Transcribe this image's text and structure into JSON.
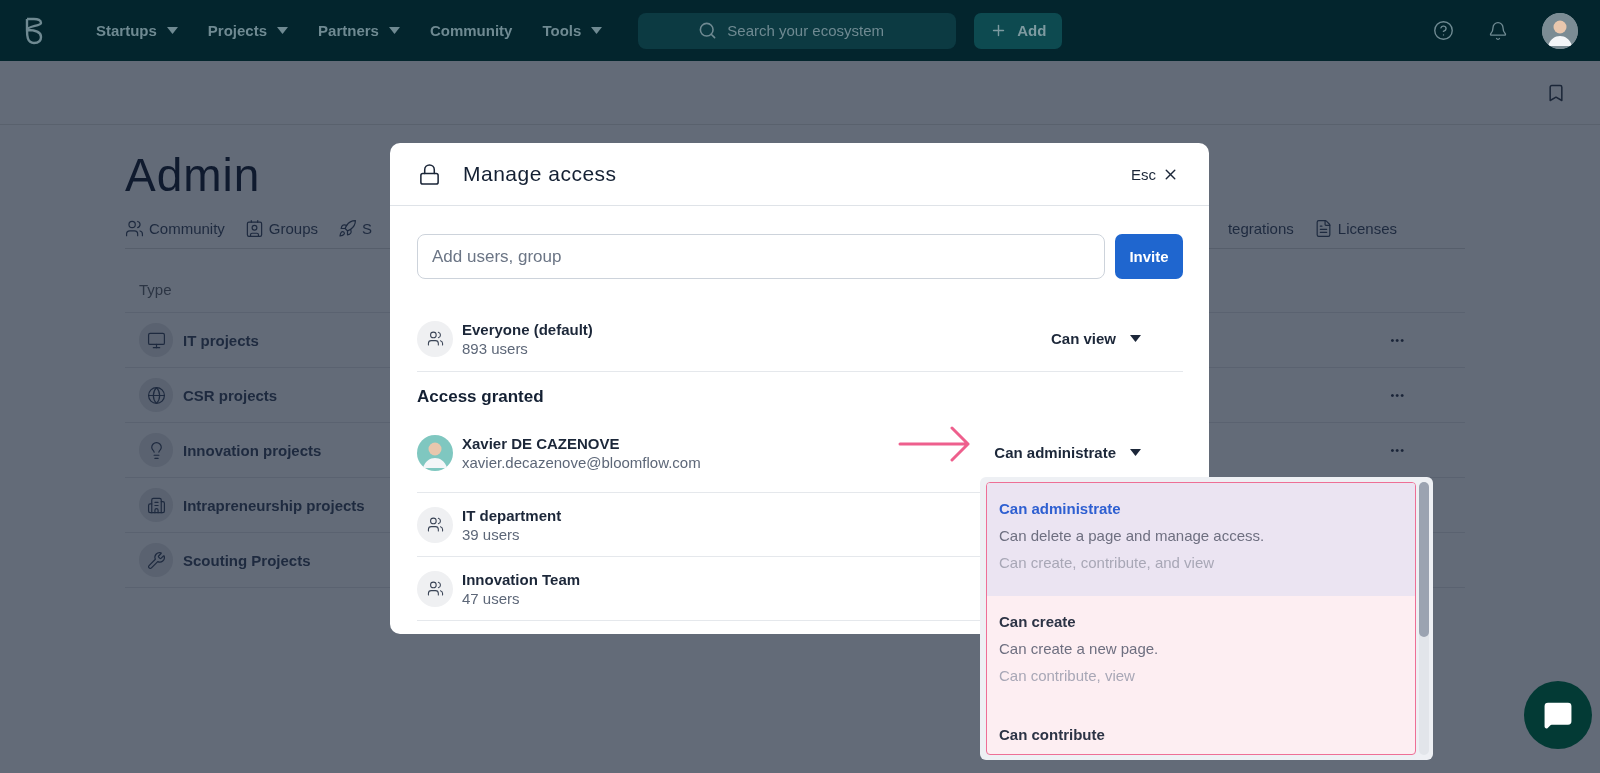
{
  "nav": {
    "menus": [
      {
        "label": "Startups",
        "kind": "dropdown"
      },
      {
        "label": "Projects",
        "kind": "dropdown"
      },
      {
        "label": "Partners",
        "kind": "dropdown"
      },
      {
        "label": "Community",
        "kind": "link"
      },
      {
        "label": "Tools",
        "kind": "dropdown"
      }
    ],
    "search": {
      "placeholder": "Search your ecosystem"
    },
    "add_button": {
      "label": "Add"
    }
  },
  "page": {
    "title": "Admin",
    "tabs": [
      {
        "label": "Community",
        "kind": "community"
      },
      {
        "label": "Groups",
        "kind": "groups"
      },
      {
        "label": "S",
        "kind": "rocket"
      },
      {
        "label": "tegrations",
        "kind": "plain"
      },
      {
        "label": "Licenses",
        "kind": "licenses"
      }
    ],
    "table": {
      "columns": [
        "Type"
      ],
      "rows": [
        {
          "name": "IT projects",
          "kind": "monitor",
          "more": "•••"
        },
        {
          "name": "CSR projects",
          "kind": "globe",
          "more": "•••"
        },
        {
          "name": "Innovation projects",
          "kind": "bulb",
          "more": "•••"
        },
        {
          "name": "Intrapreneurship projects",
          "kind": "building"
        },
        {
          "name": "Scouting Projects",
          "kind": "wrench"
        }
      ]
    }
  },
  "modal": {
    "title": "Manage access",
    "close_label": "Esc",
    "input_placeholder": "Add users, group",
    "invite": "Invite",
    "default_entry": {
      "name": "Everyone (default)",
      "detail": "893 users",
      "kind": "everyone",
      "role": "Can view"
    },
    "section": "Access granted",
    "members": [
      {
        "name": "Xavier DE CAZENOVE",
        "detail": "xavier.decazenove@bloomflow.com",
        "kind": "person",
        "role": "Can administrate"
      },
      {
        "name": "IT department",
        "detail": "39 users",
        "kind": "group"
      },
      {
        "name": "Innovation Team",
        "detail": "47 users",
        "kind": "group"
      }
    ]
  },
  "role_menu": {
    "options": [
      {
        "title": "Can administrate",
        "description": "Can delete a page and manage access.",
        "includes": "Can create, contribute, and view",
        "selected": true
      },
      {
        "title": "Can create",
        "description": "Can create a new page.",
        "includes": "Can contribute, view",
        "selected": false
      },
      {
        "title": "Can contribute",
        "selected": false
      }
    ]
  }
}
